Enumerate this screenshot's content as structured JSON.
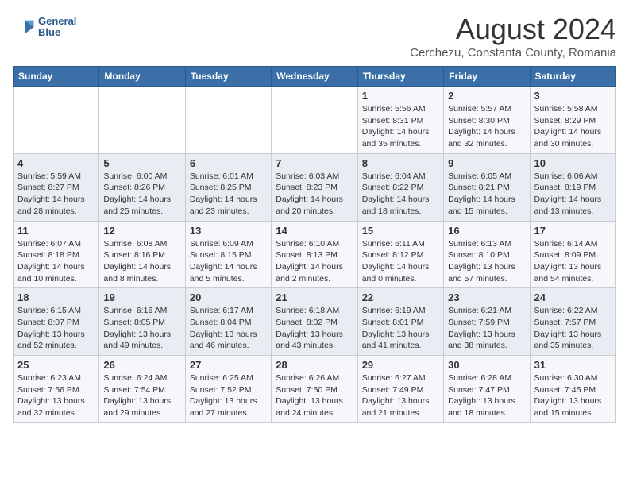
{
  "header": {
    "logo_line1": "General",
    "logo_line2": "Blue",
    "month_year": "August 2024",
    "location": "Cerchezu, Constanta County, Romania"
  },
  "weekdays": [
    "Sunday",
    "Monday",
    "Tuesday",
    "Wednesday",
    "Thursday",
    "Friday",
    "Saturday"
  ],
  "weeks": [
    [
      {
        "day": "",
        "info": ""
      },
      {
        "day": "",
        "info": ""
      },
      {
        "day": "",
        "info": ""
      },
      {
        "day": "",
        "info": ""
      },
      {
        "day": "1",
        "info": "Sunrise: 5:56 AM\nSunset: 8:31 PM\nDaylight: 14 hours\nand 35 minutes."
      },
      {
        "day": "2",
        "info": "Sunrise: 5:57 AM\nSunset: 8:30 PM\nDaylight: 14 hours\nand 32 minutes."
      },
      {
        "day": "3",
        "info": "Sunrise: 5:58 AM\nSunset: 8:29 PM\nDaylight: 14 hours\nand 30 minutes."
      }
    ],
    [
      {
        "day": "4",
        "info": "Sunrise: 5:59 AM\nSunset: 8:27 PM\nDaylight: 14 hours\nand 28 minutes."
      },
      {
        "day": "5",
        "info": "Sunrise: 6:00 AM\nSunset: 8:26 PM\nDaylight: 14 hours\nand 25 minutes."
      },
      {
        "day": "6",
        "info": "Sunrise: 6:01 AM\nSunset: 8:25 PM\nDaylight: 14 hours\nand 23 minutes."
      },
      {
        "day": "7",
        "info": "Sunrise: 6:03 AM\nSunset: 8:23 PM\nDaylight: 14 hours\nand 20 minutes."
      },
      {
        "day": "8",
        "info": "Sunrise: 6:04 AM\nSunset: 8:22 PM\nDaylight: 14 hours\nand 18 minutes."
      },
      {
        "day": "9",
        "info": "Sunrise: 6:05 AM\nSunset: 8:21 PM\nDaylight: 14 hours\nand 15 minutes."
      },
      {
        "day": "10",
        "info": "Sunrise: 6:06 AM\nSunset: 8:19 PM\nDaylight: 14 hours\nand 13 minutes."
      }
    ],
    [
      {
        "day": "11",
        "info": "Sunrise: 6:07 AM\nSunset: 8:18 PM\nDaylight: 14 hours\nand 10 minutes."
      },
      {
        "day": "12",
        "info": "Sunrise: 6:08 AM\nSunset: 8:16 PM\nDaylight: 14 hours\nand 8 minutes."
      },
      {
        "day": "13",
        "info": "Sunrise: 6:09 AM\nSunset: 8:15 PM\nDaylight: 14 hours\nand 5 minutes."
      },
      {
        "day": "14",
        "info": "Sunrise: 6:10 AM\nSunset: 8:13 PM\nDaylight: 14 hours\nand 2 minutes."
      },
      {
        "day": "15",
        "info": "Sunrise: 6:11 AM\nSunset: 8:12 PM\nDaylight: 14 hours\nand 0 minutes."
      },
      {
        "day": "16",
        "info": "Sunrise: 6:13 AM\nSunset: 8:10 PM\nDaylight: 13 hours\nand 57 minutes."
      },
      {
        "day": "17",
        "info": "Sunrise: 6:14 AM\nSunset: 8:09 PM\nDaylight: 13 hours\nand 54 minutes."
      }
    ],
    [
      {
        "day": "18",
        "info": "Sunrise: 6:15 AM\nSunset: 8:07 PM\nDaylight: 13 hours\nand 52 minutes."
      },
      {
        "day": "19",
        "info": "Sunrise: 6:16 AM\nSunset: 8:05 PM\nDaylight: 13 hours\nand 49 minutes."
      },
      {
        "day": "20",
        "info": "Sunrise: 6:17 AM\nSunset: 8:04 PM\nDaylight: 13 hours\nand 46 minutes."
      },
      {
        "day": "21",
        "info": "Sunrise: 6:18 AM\nSunset: 8:02 PM\nDaylight: 13 hours\nand 43 minutes."
      },
      {
        "day": "22",
        "info": "Sunrise: 6:19 AM\nSunset: 8:01 PM\nDaylight: 13 hours\nand 41 minutes."
      },
      {
        "day": "23",
        "info": "Sunrise: 6:21 AM\nSunset: 7:59 PM\nDaylight: 13 hours\nand 38 minutes."
      },
      {
        "day": "24",
        "info": "Sunrise: 6:22 AM\nSunset: 7:57 PM\nDaylight: 13 hours\nand 35 minutes."
      }
    ],
    [
      {
        "day": "25",
        "info": "Sunrise: 6:23 AM\nSunset: 7:56 PM\nDaylight: 13 hours\nand 32 minutes."
      },
      {
        "day": "26",
        "info": "Sunrise: 6:24 AM\nSunset: 7:54 PM\nDaylight: 13 hours\nand 29 minutes."
      },
      {
        "day": "27",
        "info": "Sunrise: 6:25 AM\nSunset: 7:52 PM\nDaylight: 13 hours\nand 27 minutes."
      },
      {
        "day": "28",
        "info": "Sunrise: 6:26 AM\nSunset: 7:50 PM\nDaylight: 13 hours\nand 24 minutes."
      },
      {
        "day": "29",
        "info": "Sunrise: 6:27 AM\nSunset: 7:49 PM\nDaylight: 13 hours\nand 21 minutes."
      },
      {
        "day": "30",
        "info": "Sunrise: 6:28 AM\nSunset: 7:47 PM\nDaylight: 13 hours\nand 18 minutes."
      },
      {
        "day": "31",
        "info": "Sunrise: 6:30 AM\nSunset: 7:45 PM\nDaylight: 13 hours\nand 15 minutes."
      }
    ]
  ]
}
